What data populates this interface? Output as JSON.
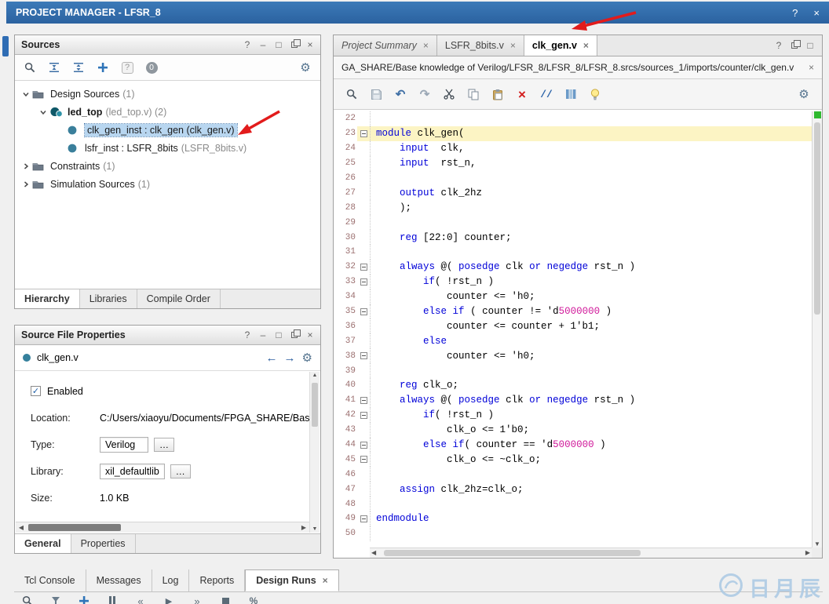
{
  "title_bar": {
    "title": "PROJECT MANAGER - LFSR_8",
    "icons": [
      "help",
      "close"
    ]
  },
  "sources": {
    "title": "Sources",
    "window_icons": [
      "help",
      "minimize",
      "maximize",
      "float",
      "close"
    ],
    "toolbar_icons": [
      "search",
      "collapse-all",
      "expand-all",
      "add",
      "help-box"
    ],
    "badge_count": "0",
    "tree": [
      {
        "indent": 0,
        "chevron": "down",
        "icon": "folder",
        "text": "Design Sources",
        "suffix": " (1)"
      },
      {
        "indent": 1,
        "chevron": "down",
        "icon": "module-top",
        "text": "led_top",
        "bold": true,
        "suffix": " (led_top.v) (2)"
      },
      {
        "indent": 2,
        "chevron": "none",
        "icon": "module",
        "text": "clk_gen_inst : clk_gen (clk_gen.v)",
        "selected": true
      },
      {
        "indent": 2,
        "chevron": "none",
        "icon": "module",
        "text": "lsfr_inst : LSFR_8bits",
        "suffix": " (LSFR_8bits.v)"
      },
      {
        "indent": 0,
        "chevron": "right",
        "icon": "folder",
        "text": "Constraints",
        "suffix": " (1)"
      },
      {
        "indent": 0,
        "chevron": "right",
        "icon": "folder",
        "text": "Simulation Sources",
        "suffix": " (1)"
      }
    ],
    "tabs": [
      {
        "label": "Hierarchy",
        "active": true
      },
      {
        "label": "Libraries"
      },
      {
        "label": "Compile Order"
      }
    ]
  },
  "properties": {
    "title": "Source File Properties",
    "window_icons": [
      "help",
      "minimize",
      "maximize",
      "float",
      "close"
    ],
    "file_name": "clk_gen.v",
    "enabled_label": "Enabled",
    "enabled_checked": true,
    "fields": [
      {
        "label": "Location:",
        "value": "C:/Users/xiaoyu/Documents/FPGA_SHARE/Bas",
        "kind": "text"
      },
      {
        "label": "Type:",
        "value": "Verilog",
        "kind": "input"
      },
      {
        "label": "Library:",
        "value": "xil_defaultlib",
        "kind": "input"
      },
      {
        "label": "Size:",
        "value": "1.0 KB",
        "kind": "text"
      }
    ],
    "tabs": [
      {
        "label": "General",
        "active": true
      },
      {
        "label": "Properties"
      }
    ]
  },
  "editor": {
    "tabs": [
      {
        "label": "Project Summary",
        "closable": true,
        "italic": true
      },
      {
        "label": "LSFR_8bits.v",
        "closable": true
      },
      {
        "label": "clk_gen.v",
        "closable": true,
        "active": true
      }
    ],
    "window_icons": [
      "help",
      "float",
      "maximize"
    ],
    "path": "GA_SHARE/Base knowledge of Verilog/LFSR_8/LFSR_8/LFSR_8.srcs/sources_1/imports/counter/clk_gen.v",
    "toolbar_icons": [
      "search",
      "save",
      "undo",
      "redo",
      "cut",
      "copy",
      "paste",
      "delete",
      "comment",
      "columns",
      "lightbulb"
    ],
    "code_lines": [
      {
        "n": 22,
        "s": []
      },
      {
        "n": 23,
        "f": 1,
        "hl": 1,
        "s": [
          [
            "k",
            "module"
          ],
          [
            "t",
            " clk_gen("
          ]
        ]
      },
      {
        "n": 24,
        "s": [
          [
            "t",
            "    "
          ],
          [
            "k",
            "input"
          ],
          [
            "t",
            "  clk,"
          ]
        ]
      },
      {
        "n": 25,
        "s": [
          [
            "t",
            "    "
          ],
          [
            "k",
            "input"
          ],
          [
            "t",
            "  rst_n,"
          ]
        ]
      },
      {
        "n": 26,
        "s": []
      },
      {
        "n": 27,
        "s": [
          [
            "t",
            "    "
          ],
          [
            "k",
            "output"
          ],
          [
            "t",
            " clk_2hz"
          ]
        ]
      },
      {
        "n": 28,
        "s": [
          [
            "t",
            "    );"
          ]
        ]
      },
      {
        "n": 29,
        "s": []
      },
      {
        "n": 30,
        "s": [
          [
            "t",
            "    "
          ],
          [
            "k",
            "reg"
          ],
          [
            "t",
            " [22:0] counter;"
          ]
        ]
      },
      {
        "n": 31,
        "s": []
      },
      {
        "n": 32,
        "f": 1,
        "s": [
          [
            "t",
            "    "
          ],
          [
            "k",
            "always"
          ],
          [
            "t",
            " @( "
          ],
          [
            "k",
            "posedge"
          ],
          [
            "t",
            " clk "
          ],
          [
            "k",
            "or"
          ],
          [
            "t",
            " "
          ],
          [
            "k",
            "negedge"
          ],
          [
            "t",
            " rst_n )"
          ]
        ]
      },
      {
        "n": 33,
        "f": 1,
        "s": [
          [
            "t",
            "        "
          ],
          [
            "k",
            "if"
          ],
          [
            "t",
            "( !rst_n )"
          ]
        ]
      },
      {
        "n": 34,
        "s": [
          [
            "t",
            "            counter <= 'h0;"
          ]
        ]
      },
      {
        "n": 35,
        "f": 1,
        "s": [
          [
            "t",
            "        "
          ],
          [
            "k",
            "else"
          ],
          [
            "t",
            " "
          ],
          [
            "k",
            "if"
          ],
          [
            "t",
            " ( counter != 'd"
          ],
          [
            "m",
            "5000000"
          ],
          [
            "t",
            " )"
          ]
        ]
      },
      {
        "n": 36,
        "s": [
          [
            "t",
            "            counter <= counter + 1'b1;"
          ]
        ]
      },
      {
        "n": 37,
        "s": [
          [
            "t",
            "        "
          ],
          [
            "k",
            "else"
          ]
        ]
      },
      {
        "n": 38,
        "f": 1,
        "s": [
          [
            "t",
            "            counter <= 'h0;"
          ]
        ]
      },
      {
        "n": 39,
        "s": []
      },
      {
        "n": 40,
        "s": [
          [
            "t",
            "    "
          ],
          [
            "k",
            "reg"
          ],
          [
            "t",
            " clk_o;"
          ]
        ]
      },
      {
        "n": 41,
        "f": 1,
        "s": [
          [
            "t",
            "    "
          ],
          [
            "k",
            "always"
          ],
          [
            "t",
            " @( "
          ],
          [
            "k",
            "posedge"
          ],
          [
            "t",
            " clk "
          ],
          [
            "k",
            "or"
          ],
          [
            "t",
            " "
          ],
          [
            "k",
            "negedge"
          ],
          [
            "t",
            " rst_n )"
          ]
        ]
      },
      {
        "n": 42,
        "f": 1,
        "s": [
          [
            "t",
            "        "
          ],
          [
            "k",
            "if"
          ],
          [
            "t",
            "( !rst_n )"
          ]
        ]
      },
      {
        "n": 43,
        "s": [
          [
            "t",
            "            clk_o <= 1'b0;"
          ]
        ]
      },
      {
        "n": 44,
        "f": 1,
        "s": [
          [
            "t",
            "        "
          ],
          [
            "k",
            "else"
          ],
          [
            "t",
            " "
          ],
          [
            "k",
            "if"
          ],
          [
            "t",
            "( counter == 'd"
          ],
          [
            "m",
            "5000000"
          ],
          [
            "t",
            " )"
          ]
        ]
      },
      {
        "n": 45,
        "f": 1,
        "s": [
          [
            "t",
            "            clk_o <= ~clk_o;"
          ]
        ]
      },
      {
        "n": 46,
        "s": []
      },
      {
        "n": 47,
        "s": [
          [
            "t",
            "    "
          ],
          [
            "k",
            "assign"
          ],
          [
            "t",
            " clk_2hz=clk_o;"
          ]
        ]
      },
      {
        "n": 48,
        "s": []
      },
      {
        "n": 49,
        "f": 1,
        "s": [
          [
            "k",
            "endmodule"
          ]
        ]
      },
      {
        "n": 50,
        "s": []
      }
    ]
  },
  "bottom_bar": {
    "tabs": [
      {
        "label": "Tcl Console"
      },
      {
        "label": "Messages"
      },
      {
        "label": "Log"
      },
      {
        "label": "Reports"
      },
      {
        "label": "Design Runs",
        "active": true,
        "closable": true
      }
    ],
    "toolbar_icons": [
      "search",
      "funnel",
      "add",
      "pause",
      "step-back",
      "play",
      "step-forward",
      "stop",
      "percent"
    ]
  },
  "watermark": {
    "text": "日月辰"
  },
  "colors": {
    "titlebar": "#2f6db4",
    "selection": "#b8d6f0",
    "keyword": "#0000d8",
    "number": "#d0189a",
    "line_highlight": "#fcf4c4",
    "annotation_arrow": "#e21b1b",
    "bookmark_green": "#2fb92f"
  }
}
